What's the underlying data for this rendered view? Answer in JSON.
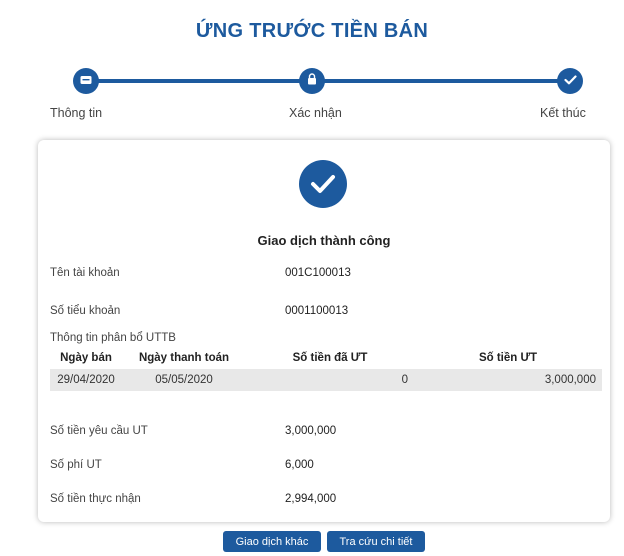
{
  "title": "ỨNG TRƯỚC TIỀN BÁN",
  "steps": [
    {
      "label": "Thông tin",
      "icon": "card-icon"
    },
    {
      "label": "Xác nhận",
      "icon": "lock-icon"
    },
    {
      "label": "Kết thúc",
      "icon": "check-icon"
    }
  ],
  "result": {
    "status_text": "Giao dịch thành công",
    "icon": "check-circle-icon"
  },
  "fields": {
    "account_name_label": "Tên tài khoản",
    "account_name_value": "001C100013",
    "sub_account_label": "Số tiểu khoản",
    "sub_account_value": "0001100013",
    "allocation_label": "Thông tin phân bổ UTTB",
    "requested_label": "Số tiền yêu cầu UT",
    "requested_value": "3,000,000",
    "fee_label": "Số phí UT",
    "fee_value": "6,000",
    "received_label": "Số tiền thực nhận",
    "received_value": "2,994,000"
  },
  "table": {
    "headers": [
      "Ngày bán",
      "Ngày thanh toán",
      "Số tiền đã ƯT",
      "Số tiền ƯT"
    ],
    "rows": [
      [
        "29/04/2020",
        "05/05/2020",
        "0",
        "3,000,000"
      ]
    ]
  },
  "buttons": {
    "other_transaction": "Giao dịch khác",
    "view_detail": "Tra cứu chi tiết"
  },
  "colors": {
    "primary": "#1d5a9e",
    "table_row_bg": "#e8e8e8"
  }
}
